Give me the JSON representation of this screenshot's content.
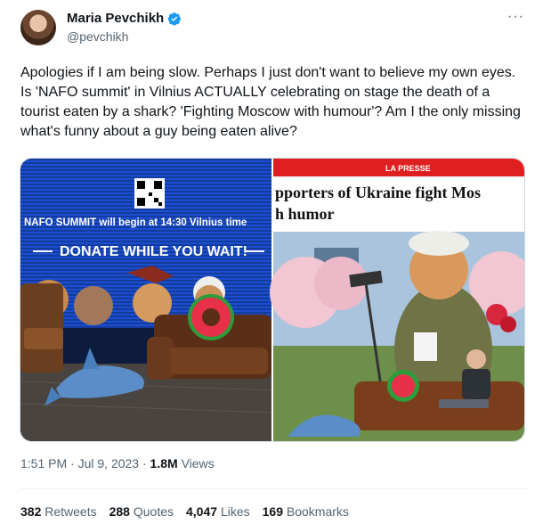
{
  "author": {
    "name": "Maria Pevchikh",
    "handle": "@pevchikh"
  },
  "more_label": "···",
  "tweet": {
    "text": "Apologies if I am being slow. Perhaps I just don't want to believe my own eyes. Is 'NAFO summit' in Vilnius ACTUALLY celebrating on stage the death of a tourist eaten by a shark? 'Fighting Moscow with humour'? Am I the only missing what's funny about a guy being eaten alive?"
  },
  "media_left": {
    "line1": "NAFO SUMMIT will begin at 14:30 Vilnius time",
    "line2": "DONATE WHILE YOU WAIT!"
  },
  "media_right": {
    "source": "LA PRESSE",
    "headline_line1": "pporters of Ukraine fight Mos",
    "headline_line2": "h humor"
  },
  "meta": {
    "time": "1:51 PM",
    "date": "Jul 9, 2023",
    "views_count": "1.8M",
    "views_label": "Views",
    "sep": "·"
  },
  "stats": [
    {
      "count": "382",
      "label": "Retweets"
    },
    {
      "count": "288",
      "label": "Quotes"
    },
    {
      "count": "4,047",
      "label": "Likes"
    },
    {
      "count": "169",
      "label": "Bookmarks"
    }
  ],
  "colors": {
    "verified": "#1d9bf0",
    "stage_blue": "#1a4fd0",
    "press_red": "#e02020"
  }
}
